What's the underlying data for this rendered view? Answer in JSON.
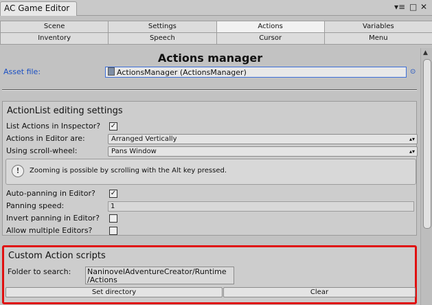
{
  "window": {
    "title": "AC Game Editor",
    "controls": [
      "▾≡",
      "□",
      "✕"
    ]
  },
  "tabs": {
    "row1": [
      {
        "label": "Scene",
        "active": false
      },
      {
        "label": "Settings",
        "active": false
      },
      {
        "label": "Actions",
        "active": true
      },
      {
        "label": "Variables",
        "active": false
      }
    ],
    "row2": [
      {
        "label": "Inventory",
        "active": false
      },
      {
        "label": "Speech",
        "active": false
      },
      {
        "label": "Cursor",
        "active": false
      },
      {
        "label": "Menu",
        "active": false
      }
    ]
  },
  "manager": {
    "title": "Actions manager",
    "asset_label": "Asset file:",
    "asset_value": "ActionsManager (ActionsManager)"
  },
  "editing": {
    "title": "ActionList editing settings",
    "list_in_inspector": {
      "label": "List Actions in Inspector?",
      "checked": true
    },
    "actions_arranged": {
      "label": "Actions in Editor are:",
      "value": "Arranged Vertically"
    },
    "scroll_wheel": {
      "label": "Using scroll-wheel:",
      "value": "Pans Window"
    },
    "help_text": "Zooming is possible by scrolling with the Alt key pressed.",
    "auto_panning": {
      "label": "Auto-panning in Editor?",
      "checked": true
    },
    "panning_speed": {
      "label": "Panning speed:",
      "value": "1"
    },
    "invert_panning": {
      "label": "Invert panning in Editor?",
      "checked": false
    },
    "multiple_editors": {
      "label": "Allow multiple Editors?",
      "checked": false
    }
  },
  "custom": {
    "title": "Custom Action scripts",
    "folder_label": "Folder to search:",
    "folder_line1": "NaninovelAdventureCreator/Runtime",
    "folder_line2": "/Actions",
    "set_directory": "Set directory",
    "clear": "Clear"
  },
  "colors": {
    "accent_blue": "#1a4fc2",
    "highlight_red": "#e01010"
  }
}
